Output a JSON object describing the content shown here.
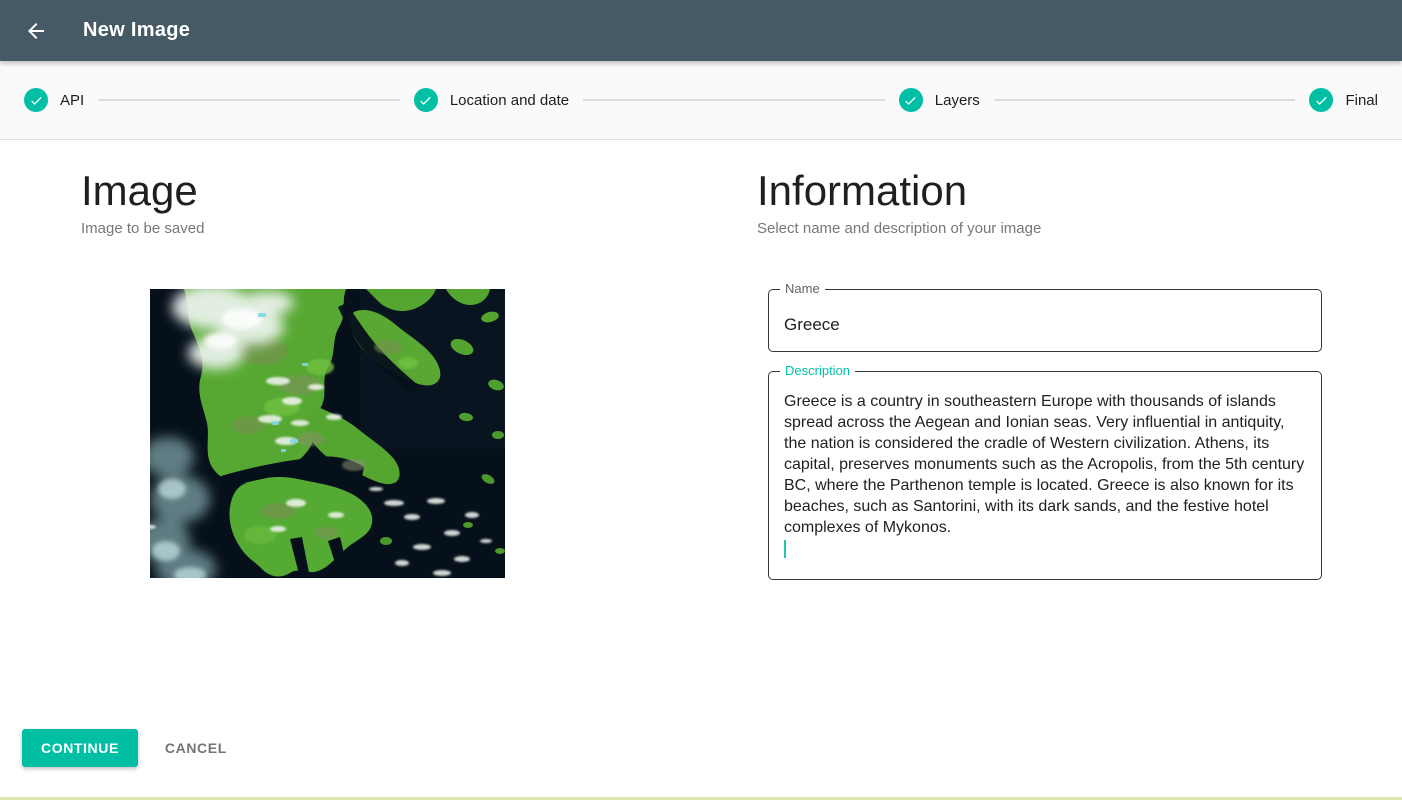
{
  "appbar": {
    "title": "New Image"
  },
  "stepper": {
    "steps": [
      {
        "label": "API",
        "state": "completed"
      },
      {
        "label": "Location and date",
        "state": "completed"
      },
      {
        "label": "Layers",
        "state": "completed"
      },
      {
        "label": "Final",
        "state": "completed"
      }
    ]
  },
  "image_section": {
    "title": "Image",
    "subtitle": "Image to be saved",
    "preview": "satellite-image-of-greece"
  },
  "info_section": {
    "title": "Information",
    "subtitle": "Select name and description of your image",
    "name_field": {
      "label": "Name",
      "value": "Greece"
    },
    "description_field": {
      "label": "Description",
      "value": "Greece is a country in southeastern Europe with thousands of islands spread across the Aegean and Ionian seas. Very influential in antiquity, the nation is considered the cradle of Western civilization. Athens, its capital, preserves monuments such as the Acropolis, from the 5th century BC, where the Parthenon temple is located. Greece is also known for its beaches, such as Santorini, with its dark sands, and the festive hotel complexes of Mykonos."
    }
  },
  "actions": {
    "continue_label": "CONTINUE",
    "cancel_label": "CANCEL"
  },
  "colors": {
    "appbar_background": "#455a64",
    "accent_teal": "#00bfa5",
    "stepper_background": "#fafafa",
    "description_label": "#00bfa5",
    "cancel_text": "#757575",
    "bottom_strip": "#dce7af"
  }
}
